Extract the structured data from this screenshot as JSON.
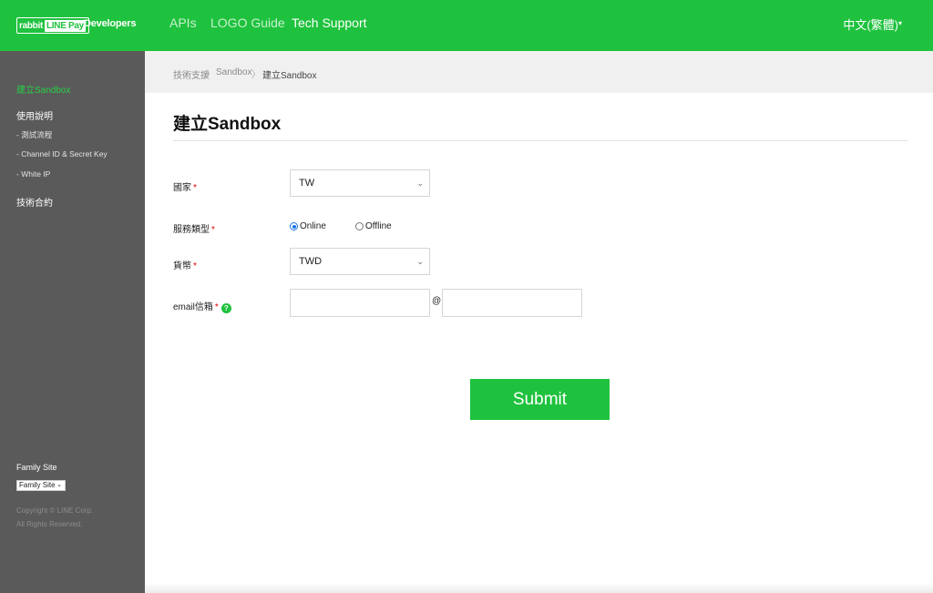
{
  "header": {
    "logo_part1": "rabbit",
    "logo_part2": "LINE Pay",
    "logo_suffix": "Developers",
    "nav": [
      "APIs",
      "LOGO Guide",
      "Tech Support"
    ],
    "language": "中文(繁體)",
    "language_caret": "▾"
  },
  "sidebar": {
    "items": [
      {
        "label": "建立Sandbox"
      },
      {
        "label": "使用說明"
      },
      {
        "label": "- 測試流程"
      },
      {
        "label": "- Channel ID & Secret Key"
      },
      {
        "label": "- White IP"
      },
      {
        "label": "技術合約"
      }
    ],
    "family_site_label": "Family Site",
    "family_site_select": "Family Site",
    "copyright_line1": "Copyright © LINE Corp.",
    "copyright_line2": "All Rights Reserved."
  },
  "breadcrumb": {
    "items": [
      "技術支援",
      "Sandbox",
      "建立Sandbox"
    ],
    "separator": "〉"
  },
  "main": {
    "title": "建立Sandbox",
    "form": {
      "country_label": "國家",
      "country_value": "TW",
      "service_type_label": "服務類型",
      "service_options": [
        "Online",
        "Offline"
      ],
      "service_selected": "Online",
      "currency_label": "貨幣",
      "currency_value": "TWD",
      "email_label": "email信箱",
      "help_icon_glyph": "?",
      "email_user": "",
      "email_domain": "",
      "at_sign": "@",
      "required_mark": "*"
    },
    "submit_label": "Submit"
  },
  "colors": {
    "brand_green": "#1fc23e",
    "sidebar_bg": "#5a5a5a",
    "required_red": "#e00000"
  }
}
